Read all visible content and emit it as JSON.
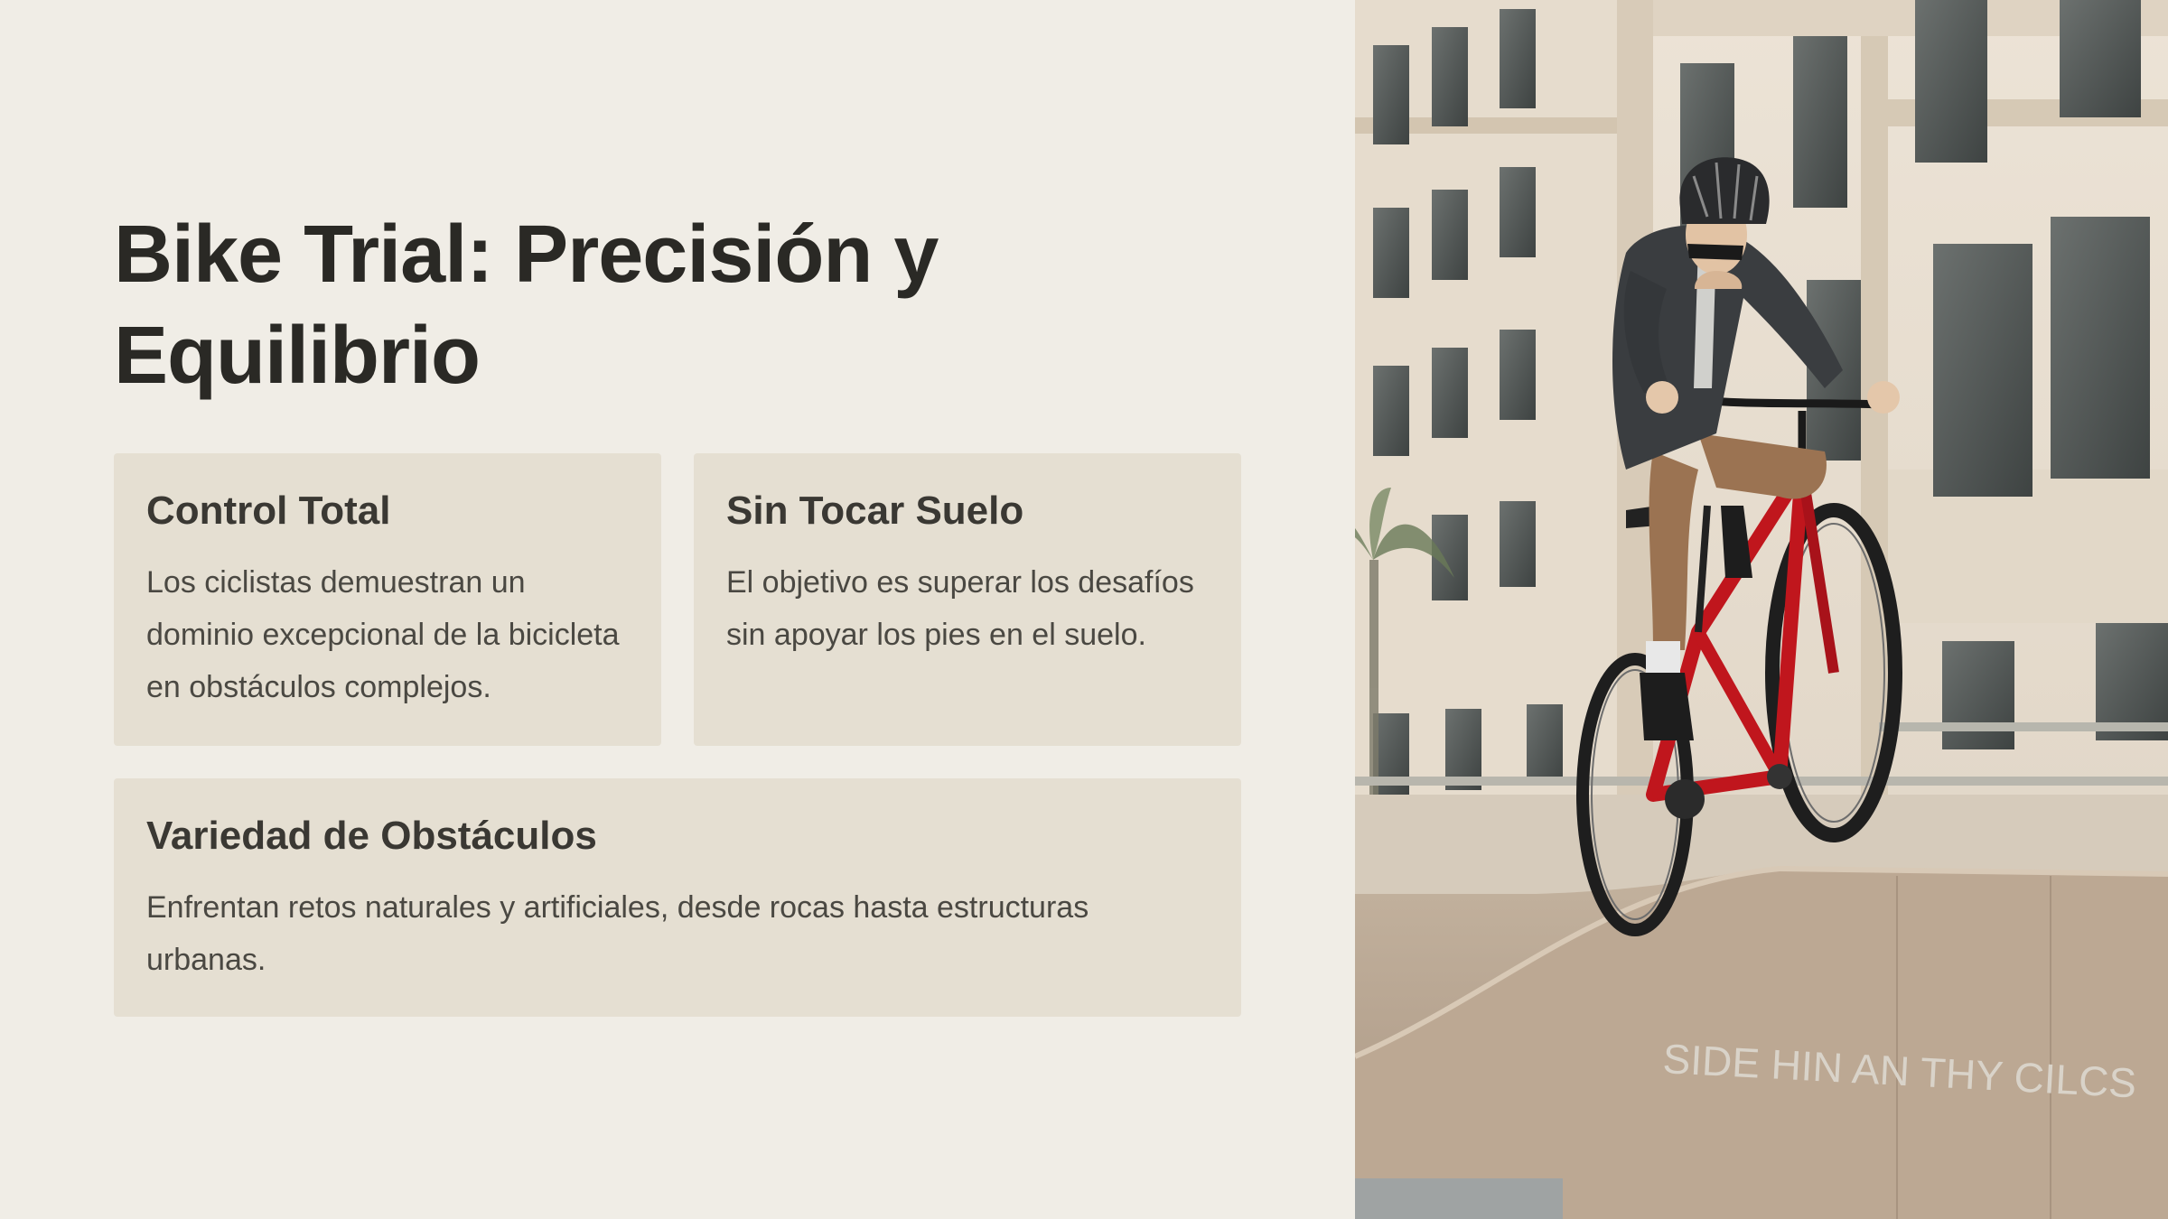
{
  "slide": {
    "title": "Bike Trial: Precisión y Equilibrio",
    "cards": [
      {
        "heading": "Control Total",
        "body": "Los ciclistas demuestran un dominio excepcional de la bicicleta en obstáculos complejos."
      },
      {
        "heading": "Sin Tocar Suelo",
        "body": "El objetivo es superar los desafíos sin apoyar los pies en el suelo."
      },
      {
        "heading": "Variedad de Obstáculos",
        "body": "Enfrentan retos naturales y artificiales, desde rocas hasta estructuras urbanas."
      }
    ]
  },
  "photo": {
    "ramp_graffiti": "SIDE HIN AN THY CILCS",
    "colors": {
      "bike": "#c0161d",
      "wall": "#e8dccb",
      "ramp": "#b9a590",
      "background": "#f0ede6",
      "card": "#e5dfd2"
    }
  }
}
